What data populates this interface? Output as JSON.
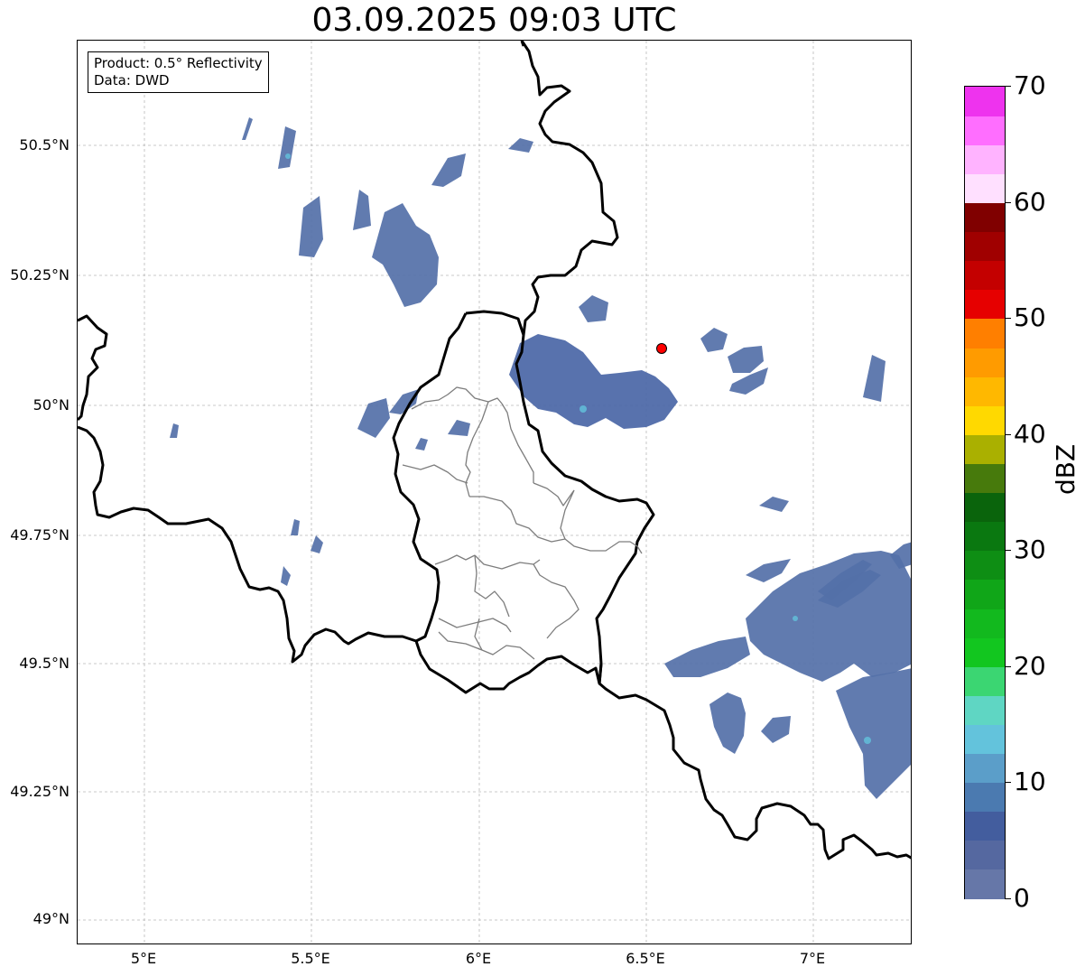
{
  "title": "03.09.2025 09:03 UTC",
  "info": {
    "product": "Product: 0.5° Reflectivity",
    "source": "Data: DWD"
  },
  "lat_labels": [
    "50.5°N",
    "50.25°N",
    "50°N",
    "49.75°N",
    "49.5°N",
    "49.25°N",
    "49°N"
  ],
  "lon_labels": [
    "5°E",
    "5.5°E",
    "6°E",
    "6.5°E",
    "7°E"
  ],
  "colorbar": {
    "unit": "dBZ",
    "ticks": [
      "0",
      "10",
      "20",
      "30",
      "40",
      "50",
      "60",
      "70"
    ],
    "colors": [
      "#6677a8",
      "#5568a0",
      "#435d9e",
      "#4b7ab0",
      "#5b9ec9",
      "#63c3dc",
      "#5fd6c3",
      "#3bd672",
      "#12c61f",
      "#12b91e",
      "#10a618",
      "#0e8e14",
      "#0a7810",
      "#0a640c",
      "#477a0c",
      "#aab000",
      "#ffd900",
      "#ffb800",
      "#ff9b00",
      "#ff7f00",
      "#e60000",
      "#c40000",
      "#a00000",
      "#800000",
      "#ffe0ff",
      "#ffb3ff",
      "#ff6eff",
      "#ee33ee"
    ]
  },
  "site_marker": {
    "color": "#ff0000"
  }
}
